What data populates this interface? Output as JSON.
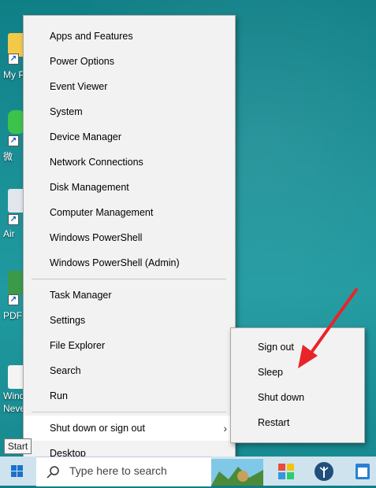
{
  "menu": {
    "items": [
      {
        "label": "Apps and Features"
      },
      {
        "label": "Power Options"
      },
      {
        "label": "Event Viewer"
      },
      {
        "label": "System"
      },
      {
        "label": "Device Manager"
      },
      {
        "label": "Network Connections"
      },
      {
        "label": "Disk Management"
      },
      {
        "label": "Computer Management"
      },
      {
        "label": "Windows PowerShell"
      },
      {
        "label": "Windows PowerShell (Admin)"
      },
      {
        "label": "Task Manager"
      },
      {
        "label": "Settings"
      },
      {
        "label": "File Explorer"
      },
      {
        "label": "Search"
      },
      {
        "label": "Run"
      },
      {
        "label": "Shut down or sign out"
      },
      {
        "label": "Desktop"
      }
    ],
    "chevron": "›"
  },
  "submenu": {
    "items": [
      {
        "label": "Sign out"
      },
      {
        "label": "Sleep"
      },
      {
        "label": "Shut down"
      },
      {
        "label": "Restart"
      }
    ]
  },
  "tooltip": {
    "text": "Start"
  },
  "taskbar": {
    "search_placeholder": "Type here to search"
  },
  "desktop": {
    "icons": [
      {
        "label": "My P"
      },
      {
        "label": "微"
      },
      {
        "label": "Air"
      },
      {
        "label": "PDF"
      },
      {
        "label": "Wind"
      },
      {
        "label": "Neve"
      }
    ]
  },
  "colors": {
    "accent": "#e8242a",
    "menu_bg": "#f2f2f2",
    "wallpaper": "#1a8f96"
  }
}
